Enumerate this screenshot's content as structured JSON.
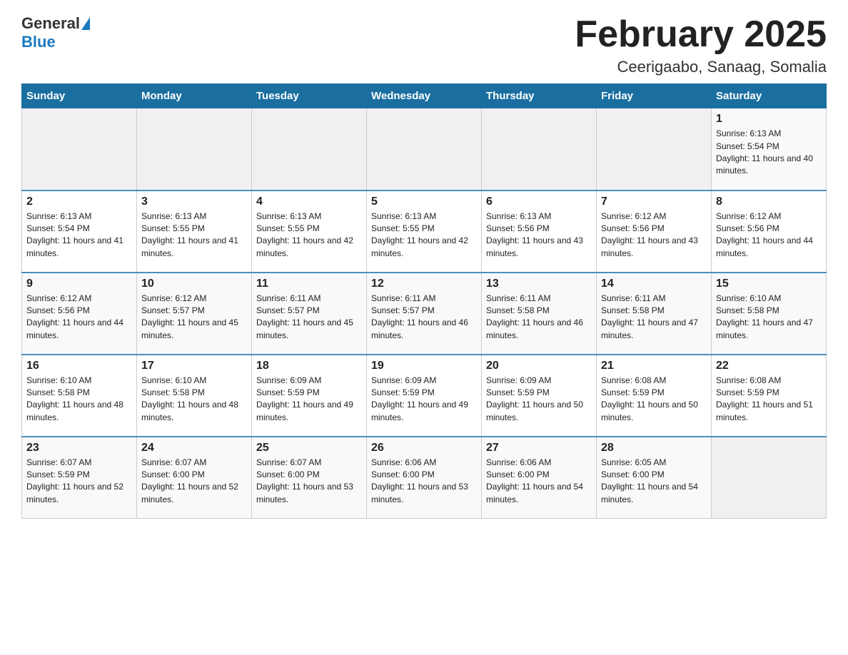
{
  "header": {
    "logo_general": "General",
    "logo_blue": "Blue",
    "month_title": "February 2025",
    "location": "Ceerigaabo, Sanaag, Somalia"
  },
  "days_of_week": [
    "Sunday",
    "Monday",
    "Tuesday",
    "Wednesday",
    "Thursday",
    "Friday",
    "Saturday"
  ],
  "weeks": [
    [
      {
        "num": "",
        "info": ""
      },
      {
        "num": "",
        "info": ""
      },
      {
        "num": "",
        "info": ""
      },
      {
        "num": "",
        "info": ""
      },
      {
        "num": "",
        "info": ""
      },
      {
        "num": "",
        "info": ""
      },
      {
        "num": "1",
        "info": "Sunrise: 6:13 AM\nSunset: 5:54 PM\nDaylight: 11 hours and 40 minutes."
      }
    ],
    [
      {
        "num": "2",
        "info": "Sunrise: 6:13 AM\nSunset: 5:54 PM\nDaylight: 11 hours and 41 minutes."
      },
      {
        "num": "3",
        "info": "Sunrise: 6:13 AM\nSunset: 5:55 PM\nDaylight: 11 hours and 41 minutes."
      },
      {
        "num": "4",
        "info": "Sunrise: 6:13 AM\nSunset: 5:55 PM\nDaylight: 11 hours and 42 minutes."
      },
      {
        "num": "5",
        "info": "Sunrise: 6:13 AM\nSunset: 5:55 PM\nDaylight: 11 hours and 42 minutes."
      },
      {
        "num": "6",
        "info": "Sunrise: 6:13 AM\nSunset: 5:56 PM\nDaylight: 11 hours and 43 minutes."
      },
      {
        "num": "7",
        "info": "Sunrise: 6:12 AM\nSunset: 5:56 PM\nDaylight: 11 hours and 43 minutes."
      },
      {
        "num": "8",
        "info": "Sunrise: 6:12 AM\nSunset: 5:56 PM\nDaylight: 11 hours and 44 minutes."
      }
    ],
    [
      {
        "num": "9",
        "info": "Sunrise: 6:12 AM\nSunset: 5:56 PM\nDaylight: 11 hours and 44 minutes."
      },
      {
        "num": "10",
        "info": "Sunrise: 6:12 AM\nSunset: 5:57 PM\nDaylight: 11 hours and 45 minutes."
      },
      {
        "num": "11",
        "info": "Sunrise: 6:11 AM\nSunset: 5:57 PM\nDaylight: 11 hours and 45 minutes."
      },
      {
        "num": "12",
        "info": "Sunrise: 6:11 AM\nSunset: 5:57 PM\nDaylight: 11 hours and 46 minutes."
      },
      {
        "num": "13",
        "info": "Sunrise: 6:11 AM\nSunset: 5:58 PM\nDaylight: 11 hours and 46 minutes."
      },
      {
        "num": "14",
        "info": "Sunrise: 6:11 AM\nSunset: 5:58 PM\nDaylight: 11 hours and 47 minutes."
      },
      {
        "num": "15",
        "info": "Sunrise: 6:10 AM\nSunset: 5:58 PM\nDaylight: 11 hours and 47 minutes."
      }
    ],
    [
      {
        "num": "16",
        "info": "Sunrise: 6:10 AM\nSunset: 5:58 PM\nDaylight: 11 hours and 48 minutes."
      },
      {
        "num": "17",
        "info": "Sunrise: 6:10 AM\nSunset: 5:58 PM\nDaylight: 11 hours and 48 minutes."
      },
      {
        "num": "18",
        "info": "Sunrise: 6:09 AM\nSunset: 5:59 PM\nDaylight: 11 hours and 49 minutes."
      },
      {
        "num": "19",
        "info": "Sunrise: 6:09 AM\nSunset: 5:59 PM\nDaylight: 11 hours and 49 minutes."
      },
      {
        "num": "20",
        "info": "Sunrise: 6:09 AM\nSunset: 5:59 PM\nDaylight: 11 hours and 50 minutes."
      },
      {
        "num": "21",
        "info": "Sunrise: 6:08 AM\nSunset: 5:59 PM\nDaylight: 11 hours and 50 minutes."
      },
      {
        "num": "22",
        "info": "Sunrise: 6:08 AM\nSunset: 5:59 PM\nDaylight: 11 hours and 51 minutes."
      }
    ],
    [
      {
        "num": "23",
        "info": "Sunrise: 6:07 AM\nSunset: 5:59 PM\nDaylight: 11 hours and 52 minutes."
      },
      {
        "num": "24",
        "info": "Sunrise: 6:07 AM\nSunset: 6:00 PM\nDaylight: 11 hours and 52 minutes."
      },
      {
        "num": "25",
        "info": "Sunrise: 6:07 AM\nSunset: 6:00 PM\nDaylight: 11 hours and 53 minutes."
      },
      {
        "num": "26",
        "info": "Sunrise: 6:06 AM\nSunset: 6:00 PM\nDaylight: 11 hours and 53 minutes."
      },
      {
        "num": "27",
        "info": "Sunrise: 6:06 AM\nSunset: 6:00 PM\nDaylight: 11 hours and 54 minutes."
      },
      {
        "num": "28",
        "info": "Sunrise: 6:05 AM\nSunset: 6:00 PM\nDaylight: 11 hours and 54 minutes."
      },
      {
        "num": "",
        "info": ""
      }
    ]
  ]
}
